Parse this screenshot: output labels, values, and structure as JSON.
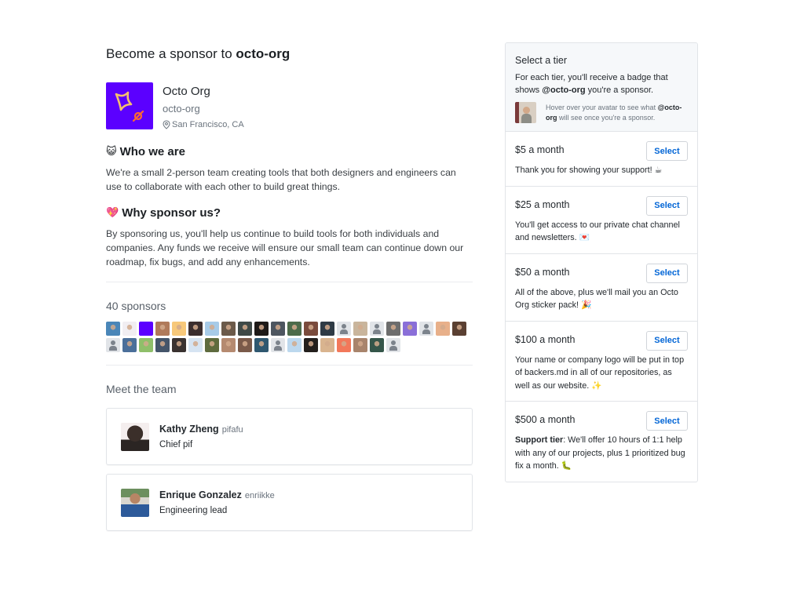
{
  "header": {
    "title_prefix": "Become a sponsor to ",
    "title_org": "octo-org"
  },
  "org": {
    "logo_icon": "octo-org-logo",
    "logo_color": "#5b00ff",
    "name": "Octo Org",
    "login": "octo-org",
    "location_icon": "location-pin-icon",
    "location": "San Francisco, CA"
  },
  "sections": [
    {
      "emoji": "😺",
      "emoji_icon": "smiley-cat-icon",
      "heading": "Who we are",
      "body": "We're a small 2-person team creating tools that both designers and engineers can use to collaborate with each other to build great things."
    },
    {
      "emoji": "💖",
      "emoji_icon": "sparkling-heart-icon",
      "heading": "Why sponsor us?",
      "body": "By sponsoring us, you'll help us continue to build tools for both individuals and companies. Any funds we receive will ensure our small team can continue down our roadmap, fix bugs, and add any enhancements."
    }
  ],
  "sponsors": {
    "count_label": "40 sponsors",
    "count": 40,
    "avatars": [
      {
        "kind": "photo",
        "color": "#4a86b8"
      },
      {
        "kind": "photo",
        "color": "#f1eef2"
      },
      {
        "kind": "solid",
        "color": "#5b00ff"
      },
      {
        "kind": "photo",
        "color": "#b07a5a"
      },
      {
        "kind": "photo",
        "color": "#f7c87a"
      },
      {
        "kind": "photo",
        "color": "#3b2e2e"
      },
      {
        "kind": "photo",
        "color": "#a7cbe8"
      },
      {
        "kind": "photo",
        "color": "#6b5a4a"
      },
      {
        "kind": "photo",
        "color": "#3f4a48"
      },
      {
        "kind": "photo",
        "color": "#1e1a18"
      },
      {
        "kind": "photo",
        "color": "#4d5660"
      },
      {
        "kind": "photo",
        "color": "#4c6b4a"
      },
      {
        "kind": "photo",
        "color": "#7a4b3c"
      },
      {
        "kind": "photo",
        "color": "#2e3a45"
      },
      {
        "kind": "ghost",
        "color": "#e1e4e8"
      },
      {
        "kind": "photo",
        "color": "#c9b59c"
      },
      {
        "kind": "ghost",
        "color": "#e1e4e8"
      },
      {
        "kind": "photo",
        "color": "#6d6d6d"
      },
      {
        "kind": "photo",
        "color": "#8a6fd8"
      },
      {
        "kind": "ghost",
        "color": "#e1e4e8"
      },
      {
        "kind": "photo",
        "color": "#e8b08a"
      },
      {
        "kind": "photo",
        "color": "#5a4032"
      },
      {
        "kind": "ghost",
        "color": "#e1e4e8"
      },
      {
        "kind": "photo",
        "color": "#4b6f9a"
      },
      {
        "kind": "photo",
        "color": "#8fbf6a"
      },
      {
        "kind": "photo",
        "color": "#44556a"
      },
      {
        "kind": "photo",
        "color": "#3a3230"
      },
      {
        "kind": "photo",
        "color": "#d6e4f2"
      },
      {
        "kind": "photo",
        "color": "#5e6b3e"
      },
      {
        "kind": "photo",
        "color": "#b58a70"
      },
      {
        "kind": "photo",
        "color": "#7a5a4a"
      },
      {
        "kind": "photo",
        "color": "#2f5870"
      },
      {
        "kind": "ghost",
        "color": "#e1e4e8"
      },
      {
        "kind": "photo",
        "color": "#bcd8ee"
      },
      {
        "kind": "photo",
        "color": "#231f1d"
      },
      {
        "kind": "photo",
        "color": "#d9b48f"
      },
      {
        "kind": "photo",
        "color": "#f2785a"
      },
      {
        "kind": "photo",
        "color": "#a8846c"
      },
      {
        "kind": "photo",
        "color": "#35564a"
      },
      {
        "kind": "ghost",
        "color": "#e1e4e8"
      }
    ]
  },
  "team": {
    "heading": "Meet the team",
    "members": [
      {
        "name": "Kathy Zheng",
        "login": "pifafu",
        "role": "Chief pif",
        "avatar_color": "#2b2523"
      },
      {
        "name": "Enrique Gonzalez",
        "login": "enriikke",
        "role": "Engineering lead",
        "avatar_color": "#2d5a9a"
      }
    ]
  },
  "tiers_panel": {
    "title": "Select a tier",
    "desc_prefix": "For each tier, you'll receive a badge that shows ",
    "desc_org": "@octo-org",
    "desc_suffix": " you're a sponsor.",
    "hover_prefix": "Hover over your avatar to see what ",
    "hover_org": "@octo-org",
    "hover_suffix": " will see once you're a sponsor.",
    "select_label": "Select",
    "accent_color": "#0366d6",
    "tiers": [
      {
        "price": "$5 a month",
        "desc_bold": "",
        "desc": "Thank you for showing your support! ☕"
      },
      {
        "price": "$25 a month",
        "desc_bold": "",
        "desc": "You'll get access to our private chat channel and newsletters. 💌"
      },
      {
        "price": "$50 a month",
        "desc_bold": "",
        "desc": "All of the above, plus we'll mail you an Octo Org sticker pack! 🎉"
      },
      {
        "price": "$100 a month",
        "desc_bold": "",
        "desc": "Your name or company logo will be put in top of backers.md in all of our repositories, as well as our website. ✨"
      },
      {
        "price": "$500 a month",
        "desc_bold": "Support tier",
        "desc": ": We'll offer 10 hours of 1:1 help with any of our projects, plus 1 prioritized bug fix a month. 🐛"
      }
    ]
  }
}
